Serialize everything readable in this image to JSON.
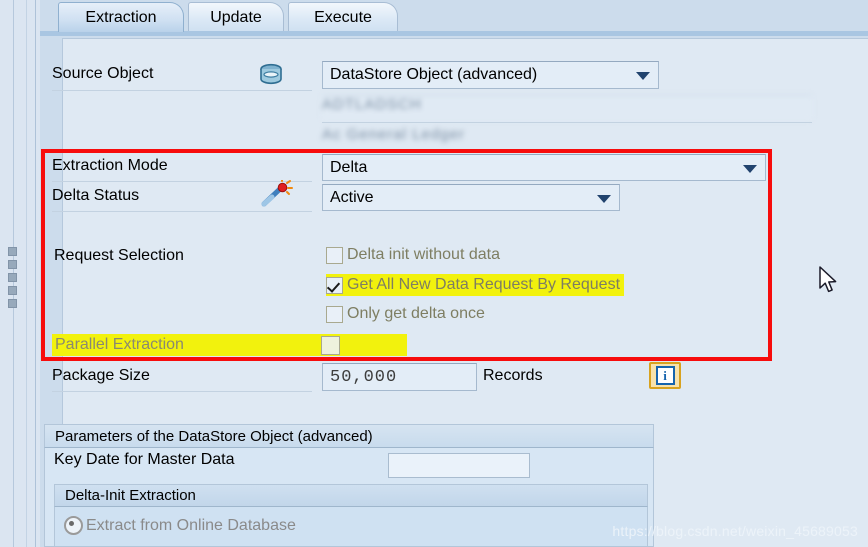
{
  "tabs": [
    {
      "label": "Extraction",
      "active": true
    },
    {
      "label": "Update",
      "active": false
    },
    {
      "label": "Execute",
      "active": false
    }
  ],
  "source_object": {
    "label": "Source Object",
    "icon": "database-icon",
    "type_value": "DataStore Object (advanced)",
    "technical_name_redacted": "ADTLADSCH",
    "description_redacted": "Ac General Ledger"
  },
  "extraction": {
    "mode_label": "Extraction Mode",
    "mode_value": "Delta",
    "delta_status_label": "Delta Status",
    "delta_status_icon": "magic-wand-icon",
    "delta_status_value": "Active",
    "request_selection_label": "Request Selection",
    "options": [
      {
        "label": "Delta init without data",
        "checked": false,
        "highlighted": false,
        "disabled": true
      },
      {
        "label": "Get All New Data Request By Request",
        "checked": true,
        "highlighted": true,
        "disabled": true
      },
      {
        "label": "Only get delta once",
        "checked": false,
        "highlighted": false,
        "disabled": true
      }
    ],
    "parallel_label": "Parallel Extraction",
    "parallel_checked": false,
    "parallel_highlighted": true
  },
  "package": {
    "label": "Package Size",
    "value": "50,000",
    "unit": "Records",
    "info_icon": "info-icon"
  },
  "parameters": {
    "header": "Parameters of the DataStore Object (advanced)",
    "key_date_label": "Key Date for Master Data",
    "key_date_value": "",
    "delta_init_header": "Delta-Init Extraction",
    "delta_init_option": "Extract from Online Database",
    "delta_init_selected": true
  },
  "watermark": "https://blog.csdn.net/weixin_45689053",
  "colors": {
    "annotation": "#f70c0c",
    "highlight": "#f2f20d",
    "panel_bg": "#dfe9f3",
    "tab_active": "#b9d2ea"
  }
}
